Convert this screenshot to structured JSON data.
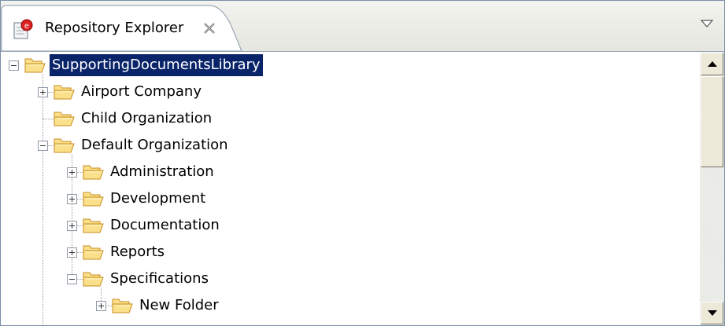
{
  "view": {
    "tab_title": "Repository Explorer",
    "tab_icon": "repository-explorer-icon",
    "close_icon": "close-icon",
    "view_menu_icon": "chevron-down-icon"
  },
  "tree": {
    "items": [
      {
        "label": "SupportingDocumentsLibrary",
        "level": 0,
        "expander": "minus",
        "selected": true,
        "icon": "open-folder-icon"
      },
      {
        "label": "Airport Company",
        "level": 1,
        "expander": "plus",
        "selected": false,
        "icon": "open-folder-icon"
      },
      {
        "label": "Child Organization",
        "level": 1,
        "expander": "none",
        "selected": false,
        "icon": "open-folder-icon"
      },
      {
        "label": "Default Organization",
        "level": 1,
        "expander": "minus",
        "selected": false,
        "icon": "open-folder-icon"
      },
      {
        "label": "Administration",
        "level": 2,
        "expander": "plus",
        "selected": false,
        "icon": "open-folder-icon"
      },
      {
        "label": "Development",
        "level": 2,
        "expander": "plus",
        "selected": false,
        "icon": "open-folder-icon"
      },
      {
        "label": "Documentation",
        "level": 2,
        "expander": "plus",
        "selected": false,
        "icon": "open-folder-icon"
      },
      {
        "label": "Reports",
        "level": 2,
        "expander": "plus",
        "selected": false,
        "icon": "open-folder-icon"
      },
      {
        "label": "Specifications",
        "level": 2,
        "expander": "minus",
        "selected": false,
        "icon": "open-folder-icon"
      },
      {
        "label": "New Folder",
        "level": 3,
        "expander": "plus",
        "selected": false,
        "icon": "open-folder-icon"
      }
    ]
  },
  "colors": {
    "selection": "#0a246a",
    "folder_fill": "#fbe08b",
    "folder_stroke": "#c78b1e"
  }
}
